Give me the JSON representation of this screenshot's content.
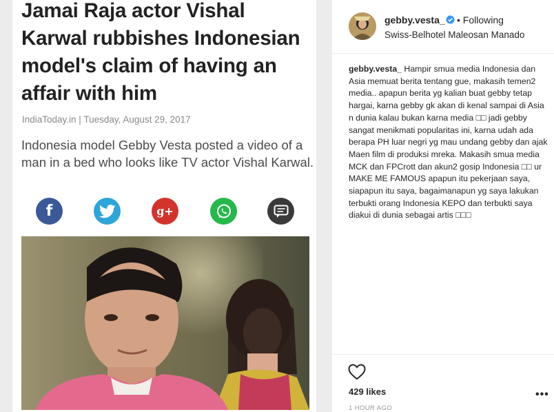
{
  "article": {
    "headline": "Jamai Raja actor Vishal Karwal rubbishes Indonesian model's claim of having an affair with him",
    "source_line": "IndiaToday.in | Tuesday, August 29, 2017",
    "summary": "Indonesia model Gebby Vesta posted a video of a man in a bed who looks like TV actor Vishal Karwal.",
    "share_icons": [
      "facebook-icon",
      "twitter-icon",
      "google-plus-icon",
      "whatsapp-icon",
      "comment-icon"
    ],
    "share_labels": {
      "facebook": "f",
      "google_plus": "g+"
    }
  },
  "post": {
    "username": "gebby.vesta_",
    "verified": true,
    "separator": "•",
    "follow_status": "Following",
    "location": "Swiss-Belhotel Maleosan Manado",
    "caption_user": "gebby.vesta_",
    "caption_text": " Hampir smua media Indonesia dan Asia memuat berita tentang gue, makasih temen2 media.. apapun berita yg kalian buat gebby tetap hargai, karna gebby gk akan di kenal sampai di Asia n dunia kalau bukan karna media □□ jadi gebby sangat menikmati popularitas ini, karna udah ada berapa PH luar negri yg mau undang gebby dan ajak Maen film di produksi mreka. Makasih smua media MCK dan FPCrott dan akun2 gosip Indonesia □□ ur MAKE ME FAMOUS apapun itu pekerjaan saya, siapapun itu saya, bagaimanapun yg saya lakukan terbukti orang Indonesia KEPO dan terbukti saya diakui di dunia sebagai artis □□□",
    "likes": "429 likes",
    "time": "1 HOUR AGO",
    "more_label": "•••"
  },
  "colors": {
    "facebook": "#3b5998",
    "twitter": "#2ea5d8",
    "google_plus": "#d2342c",
    "whatsapp": "#25b84a",
    "comment": "#3a3a3a",
    "verified": "#3897f0"
  }
}
